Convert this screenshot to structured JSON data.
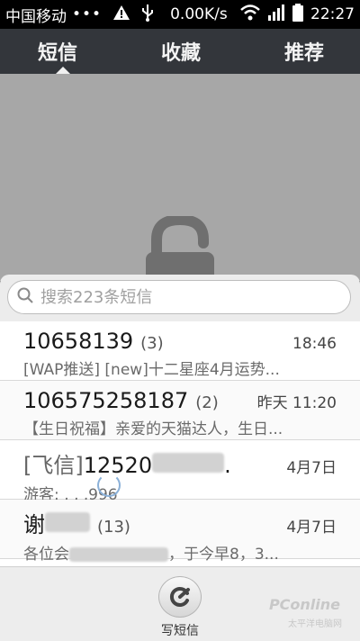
{
  "status_bar": {
    "carrier": "中国移动",
    "dots": "•••",
    "speed": "0.00K/s",
    "time": "22:27",
    "icons": [
      "warning-icon",
      "usb-icon",
      "wifi-icon",
      "signal-icon",
      "battery-icon"
    ]
  },
  "tabs": [
    {
      "label": "短信",
      "active": true
    },
    {
      "label": "收藏",
      "active": false
    },
    {
      "label": "推荐",
      "active": false
    }
  ],
  "search": {
    "placeholder": "搜索223条短信"
  },
  "messages": [
    {
      "sender": "10658139",
      "count": "(3)",
      "time": "18:46",
      "preview": "[WAP推送] [new]十二星座4月运势..."
    },
    {
      "sender": "106575258187",
      "count": "(2)",
      "time": "昨天 11:20",
      "preview": "【生日祝福】亲爱的天猫达人，生日..."
    },
    {
      "sender_prefix": "[飞信]",
      "sender": "12520",
      "sender_suffix": ".",
      "count": "",
      "time": "4月7日",
      "preview": "游客: , , ,996"
    },
    {
      "sender": "谢",
      "count": "(13)",
      "time": "4月7日",
      "preview_prefix": "各位会",
      "preview": "，于今早8，3..."
    }
  ],
  "bottom_bar": {
    "compose_label": "写短信"
  },
  "watermark": {
    "brand": "PConline",
    "sub": "太平洋电脑网"
  }
}
